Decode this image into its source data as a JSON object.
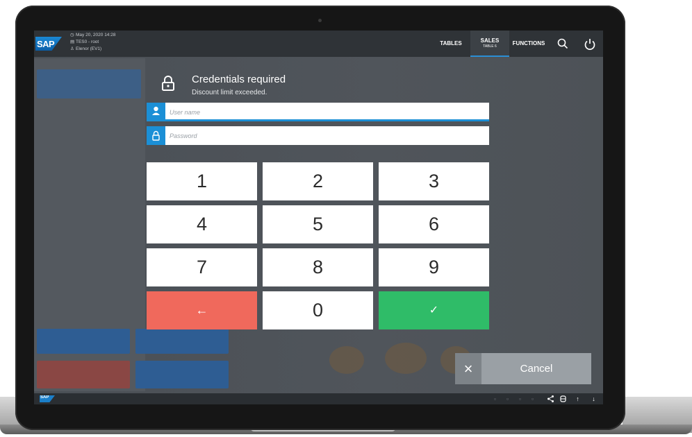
{
  "header": {
    "info": {
      "datetime": "May 20, 2020 14:28",
      "terminal": "TES0 - root",
      "user": "Elenor (EV1)"
    },
    "logo_text": "SAP",
    "nav": {
      "tables": "TABLES",
      "sales": "SALES",
      "sales_sub": "TABLE 6",
      "functions": "FUNCTIONS"
    },
    "icons": [
      "search-icon",
      "power-icon"
    ]
  },
  "dialog": {
    "title": "Credentials required",
    "subtitle": "Discount limit exceeded.",
    "username_placeholder": "User name",
    "password_placeholder": "Password",
    "keypad": {
      "k1": "1",
      "k2": "2",
      "k3": "3",
      "k4": "4",
      "k5": "5",
      "k6": "6",
      "k7": "7",
      "k8": "8",
      "k9": "9",
      "k0": "0",
      "back": "←",
      "confirm": "✓"
    },
    "cancel_label": "Cancel",
    "cancel_icon": "×"
  },
  "footer": {
    "logo_text": "SAP",
    "icons": [
      "share-icon",
      "database-icon",
      "arrow-up-icon",
      "arrow-down-icon"
    ]
  },
  "colors": {
    "accent": "#1b8fd6",
    "back_key": "#f0695c",
    "confirm_key": "#2fbc68",
    "cancel": "#9aa0a5"
  }
}
